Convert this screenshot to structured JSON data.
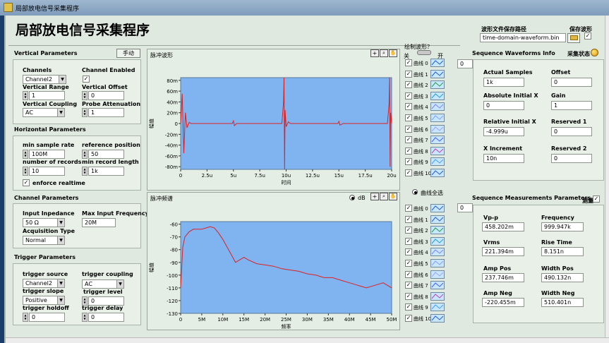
{
  "window": {
    "title": "局部放电信号采集程序",
    "app_title": "局部放电信号采集程序"
  },
  "save_path": {
    "label": "波形文件保存路径",
    "value": "time-domain-waveform.bin",
    "save_label": "保存波形",
    "save_checked": "✓"
  },
  "vertical": {
    "title": "Vertical Parameters",
    "manual_button": "手动",
    "channels_label": "Channels",
    "channels_value": "Channel2",
    "enabled_label": "Channel Enabled",
    "enabled_checked": "✓",
    "range_label": "Vertical Range",
    "range_value": "1",
    "offset_label": "Vertical Offset",
    "offset_value": "0",
    "coupling_label": "Vertical Coupling",
    "coupling_value": "AC",
    "probe_label": "Probe Attenuation",
    "probe_value": "1"
  },
  "horizontal": {
    "title": "Horizontal Parameters",
    "rate_label": "min sample rate",
    "rate_value": "100M",
    "refpos_label": "reference position",
    "refpos_value": "50",
    "records_label": "number of records",
    "records_value": "10",
    "reclen_label": "min record length",
    "reclen_value": "1k",
    "realtime_label": "enforce realtime",
    "realtime_checked": "✓"
  },
  "channel": {
    "title": "Channel Parameters",
    "impedance_label": "Input Inpedance",
    "impedance_value": "50 Ω",
    "maxfreq_label": "Max Input Frequency",
    "maxfreq_value": "20M",
    "acq_label": "Acquisition Type",
    "acq_value": "Normal"
  },
  "trigger": {
    "title": "Trigger Parameters",
    "source_label": "trigger source",
    "source_value": "Channel2",
    "coupling_label": "trigger coupling",
    "coupling_value": "AC",
    "slope_label": "trigger slope",
    "slope_value": "Positive",
    "level_label": "trigger level",
    "level_value": "0",
    "holdoff_label": "trigger holdoff",
    "holdoff_value": "0",
    "delay_label": "trigger delay",
    "delay_value": "0"
  },
  "plot_toggle": {
    "label": "绘制波形？",
    "off": "关",
    "on": "开"
  },
  "select_all": "曲线全选",
  "db_label": "dB",
  "legend_index_top": "0",
  "legend_index_bottom": "0",
  "legend": [
    {
      "name": "曲线 0",
      "checked": "✓"
    },
    {
      "name": "曲线 1",
      "checked": "✓"
    },
    {
      "name": "曲线 2",
      "checked": "✓"
    },
    {
      "name": "曲线 3",
      "checked": "✓"
    },
    {
      "name": "曲线 4",
      "checked": "✓"
    },
    {
      "name": "曲线 5",
      "checked": "✓"
    },
    {
      "name": "曲线 6",
      "checked": "✓"
    },
    {
      "name": "曲线 7",
      "checked": "✓"
    },
    {
      "name": "曲线 8",
      "checked": "✓"
    },
    {
      "name": "曲线 9",
      "checked": "✓"
    },
    {
      "name": "曲线 10",
      "checked": "✓"
    }
  ],
  "colors": {
    "plot_bg": "#7fb4f0",
    "trace": "#e02020",
    "panel": "#e4eee4"
  },
  "seq_waveforms": {
    "title": "Sequence Waveforms  Info",
    "status_label": "采集状态",
    "actual_samples_label": "Actual Samples",
    "actual_samples": "1k",
    "offset_label": "Offset",
    "offset": "0",
    "abs_x_label": "Absolute Initial X",
    "abs_x": "0",
    "gain_label": "Gain",
    "gain": "1",
    "rel_x_label": "Relative Initial X",
    "rel_x": "-4.999u",
    "res1_label": "Reserved 1",
    "res1": "0",
    "xinc_label": "X Increment",
    "xinc": "10n",
    "res2_label": "Reserved 2",
    "res2": "0"
  },
  "seq_measure": {
    "title": "Sequence Measurements Parameters",
    "measure_label": "测量",
    "measure_checked": "✓",
    "vpp_label": "Vp-p",
    "vpp": "458.202m",
    "freq_label": "Frequency",
    "freq": "999.947k",
    "vrms_label": "Vrms",
    "vrms": "221.394m",
    "rise_label": "Rise Time",
    "rise": "8.151n",
    "amppos_label": "Amp Pos",
    "amppos": "237.746m",
    "wpos_label": "Width Pos",
    "wpos": "490.132n",
    "ampneg_label": "Amp Neg",
    "ampneg": "-220.455m",
    "wneg_label": "Width Neg",
    "wneg": "510.401n"
  },
  "chart_data": [
    {
      "type": "line",
      "title": "脉冲波形",
      "xlabel": "时间",
      "ylabel": "幅值",
      "xticks": [
        "0",
        "2.5u",
        "5u",
        "7.5u",
        "10u",
        "12.5u",
        "15u",
        "17.5u",
        "20u"
      ],
      "yticks": [
        "80m",
        "60m",
        "40m",
        "20m",
        "0",
        "-20m",
        "-40m",
        "-60m",
        "-80m"
      ],
      "xlim": [
        0,
        20
      ],
      "ylim": [
        -85,
        85
      ],
      "series": [
        {
          "x": [
            0,
            0.15,
            0.3,
            0.45,
            0.6,
            0.8,
            1,
            2,
            4.9,
            5,
            5.1,
            5.3,
            6,
            9.6,
            9.75,
            9.8,
            9.85,
            9.9,
            10,
            10.2,
            10.4,
            11,
            14.9,
            15,
            15.1,
            15.4,
            16,
            19.6,
            19.75,
            19.8,
            19.85,
            19.9,
            20
          ],
          "values": [
            0,
            55,
            -55,
            20,
            -8,
            2,
            0,
            0,
            0,
            5,
            -4,
            0,
            0,
            0,
            40,
            98,
            -85,
            25,
            -6,
            3,
            0,
            0,
            0,
            4,
            -3,
            0,
            0,
            0,
            35,
            98,
            -80,
            20,
            0
          ]
        }
      ]
    },
    {
      "type": "line",
      "title": "脉冲频谱",
      "xlabel": "频率",
      "ylabel": "幅值",
      "xticks": [
        "0",
        "5M",
        "10M",
        "15M",
        "20M",
        "25M",
        "30M",
        "35M",
        "40M",
        "45M",
        "50M"
      ],
      "yticks": [
        "-60",
        "-70",
        "-80",
        "-90",
        "-100",
        "-110",
        "-120",
        "-130"
      ],
      "xlim": [
        0,
        50
      ],
      "ylim": [
        -130,
        -58
      ],
      "series": [
        {
          "x": [
            0,
            0.5,
            1,
            2,
            3,
            4,
            5,
            6,
            7,
            8,
            9,
            10,
            11,
            12,
            13,
            14,
            15,
            16,
            18,
            20,
            22,
            24,
            26,
            28,
            30,
            32,
            34,
            36,
            38,
            40,
            42,
            44,
            46,
            48,
            50
          ],
          "values": [
            -110,
            -78,
            -70,
            -66,
            -64,
            -64,
            -64,
            -63,
            -62,
            -63,
            -67,
            -72,
            -78,
            -84,
            -90,
            -88,
            -86,
            -88,
            -91,
            -92,
            -93,
            -95,
            -96,
            -97,
            -99,
            -100,
            -102,
            -102,
            -104,
            -106,
            -108,
            -110,
            -108,
            -106,
            -110
          ]
        }
      ]
    }
  ]
}
